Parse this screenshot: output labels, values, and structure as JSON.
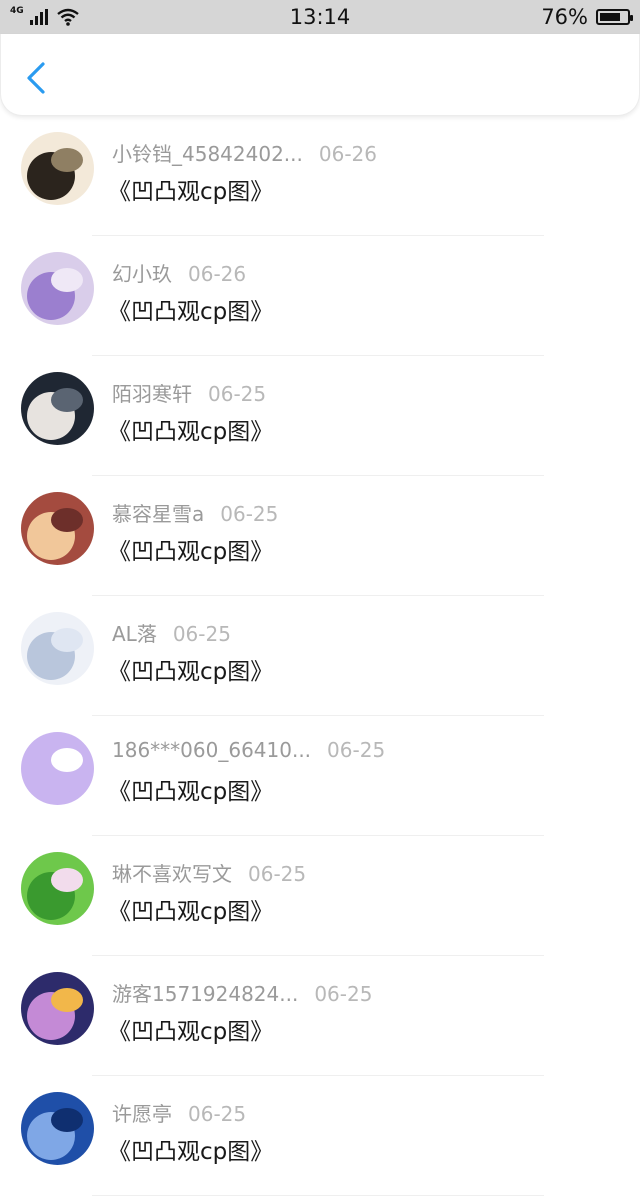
{
  "status_bar": {
    "network": "4G",
    "time": "13:14",
    "battery_percent": "76%",
    "battery_level": 0.76
  },
  "header": {
    "back_icon": "chevron-left-icon",
    "accent_color": "#2a9bf0"
  },
  "items": [
    {
      "name": "小铃铛_45842402...",
      "date": "06-26",
      "content": "《凹凸观cp图》",
      "avatar_colors": [
        "#f3e9d9",
        "#2b241d",
        "#8f7f63"
      ]
    },
    {
      "name": "幻小玖",
      "date": "06-26",
      "content": "《凹凸观cp图》",
      "avatar_colors": [
        "#d9cdea",
        "#9b7fcf",
        "#efe8f6"
      ]
    },
    {
      "name": "陌羽寒轩",
      "date": "06-25",
      "content": "《凹凸观cp图》",
      "avatar_colors": [
        "#1f2733",
        "#e7e3df",
        "#5a6472"
      ]
    },
    {
      "name": "慕容星雪a",
      "date": "06-25",
      "content": "《凹凸观cp图》",
      "avatar_colors": [
        "#a44b3f",
        "#f1c79a",
        "#6d2f2a"
      ]
    },
    {
      "name": "AL落",
      "date": "06-25",
      "content": "《凹凸观cp图》",
      "avatar_colors": [
        "#eef1f7",
        "#b9c6dc",
        "#dfe6f2"
      ]
    },
    {
      "name": "186***060_66410...",
      "date": "06-25",
      "content": "《凹凸观cp图》",
      "avatar_colors": [
        "#c9b4f0",
        "#c9b4f0",
        "#ffffff"
      ]
    },
    {
      "name": "琳不喜欢写文",
      "date": "06-25",
      "content": "《凹凸观cp图》",
      "avatar_colors": [
        "#6ec84b",
        "#3a9a2f",
        "#f2dcec"
      ]
    },
    {
      "name": "游客1571924824...",
      "date": "06-25",
      "content": "《凹凸观cp图》",
      "avatar_colors": [
        "#2d2b6b",
        "#c48ad6",
        "#f2b74a"
      ]
    },
    {
      "name": "许愿亭",
      "date": "06-25",
      "content": "《凹凸观cp图》",
      "avatar_colors": [
        "#1f4fa8",
        "#7fa7e6",
        "#0f2f70"
      ]
    }
  ]
}
